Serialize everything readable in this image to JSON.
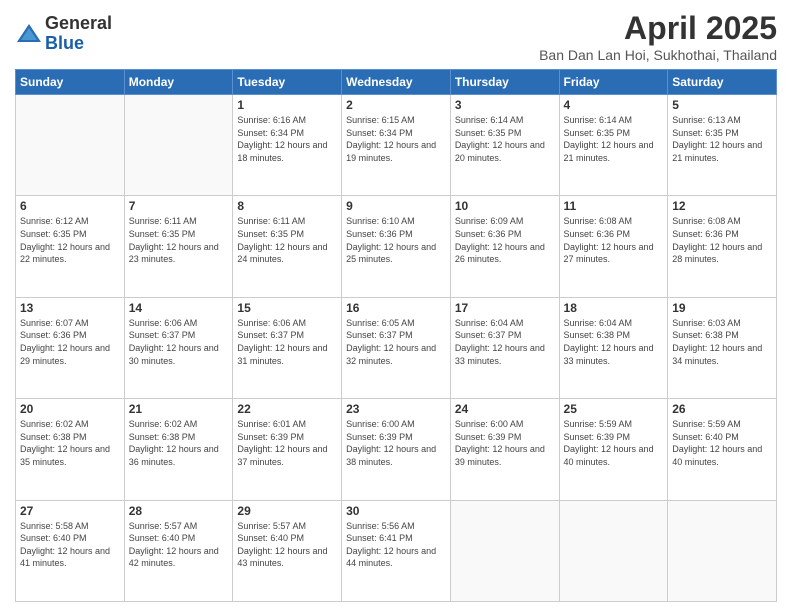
{
  "logo": {
    "general": "General",
    "blue": "Blue"
  },
  "title": "April 2025",
  "subtitle": "Ban Dan Lan Hoi, Sukhothai, Thailand",
  "days_of_week": [
    "Sunday",
    "Monday",
    "Tuesday",
    "Wednesday",
    "Thursday",
    "Friday",
    "Saturday"
  ],
  "weeks": [
    [
      {
        "day": "",
        "sunrise": "",
        "sunset": "",
        "daylight": ""
      },
      {
        "day": "",
        "sunrise": "",
        "sunset": "",
        "daylight": ""
      },
      {
        "day": "1",
        "sunrise": "Sunrise: 6:16 AM",
        "sunset": "Sunset: 6:34 PM",
        "daylight": "Daylight: 12 hours and 18 minutes."
      },
      {
        "day": "2",
        "sunrise": "Sunrise: 6:15 AM",
        "sunset": "Sunset: 6:34 PM",
        "daylight": "Daylight: 12 hours and 19 minutes."
      },
      {
        "day": "3",
        "sunrise": "Sunrise: 6:14 AM",
        "sunset": "Sunset: 6:35 PM",
        "daylight": "Daylight: 12 hours and 20 minutes."
      },
      {
        "day": "4",
        "sunrise": "Sunrise: 6:14 AM",
        "sunset": "Sunset: 6:35 PM",
        "daylight": "Daylight: 12 hours and 21 minutes."
      },
      {
        "day": "5",
        "sunrise": "Sunrise: 6:13 AM",
        "sunset": "Sunset: 6:35 PM",
        "daylight": "Daylight: 12 hours and 21 minutes."
      }
    ],
    [
      {
        "day": "6",
        "sunrise": "Sunrise: 6:12 AM",
        "sunset": "Sunset: 6:35 PM",
        "daylight": "Daylight: 12 hours and 22 minutes."
      },
      {
        "day": "7",
        "sunrise": "Sunrise: 6:11 AM",
        "sunset": "Sunset: 6:35 PM",
        "daylight": "Daylight: 12 hours and 23 minutes."
      },
      {
        "day": "8",
        "sunrise": "Sunrise: 6:11 AM",
        "sunset": "Sunset: 6:35 PM",
        "daylight": "Daylight: 12 hours and 24 minutes."
      },
      {
        "day": "9",
        "sunrise": "Sunrise: 6:10 AM",
        "sunset": "Sunset: 6:36 PM",
        "daylight": "Daylight: 12 hours and 25 minutes."
      },
      {
        "day": "10",
        "sunrise": "Sunrise: 6:09 AM",
        "sunset": "Sunset: 6:36 PM",
        "daylight": "Daylight: 12 hours and 26 minutes."
      },
      {
        "day": "11",
        "sunrise": "Sunrise: 6:08 AM",
        "sunset": "Sunset: 6:36 PM",
        "daylight": "Daylight: 12 hours and 27 minutes."
      },
      {
        "day": "12",
        "sunrise": "Sunrise: 6:08 AM",
        "sunset": "Sunset: 6:36 PM",
        "daylight": "Daylight: 12 hours and 28 minutes."
      }
    ],
    [
      {
        "day": "13",
        "sunrise": "Sunrise: 6:07 AM",
        "sunset": "Sunset: 6:36 PM",
        "daylight": "Daylight: 12 hours and 29 minutes."
      },
      {
        "day": "14",
        "sunrise": "Sunrise: 6:06 AM",
        "sunset": "Sunset: 6:37 PM",
        "daylight": "Daylight: 12 hours and 30 minutes."
      },
      {
        "day": "15",
        "sunrise": "Sunrise: 6:06 AM",
        "sunset": "Sunset: 6:37 PM",
        "daylight": "Daylight: 12 hours and 31 minutes."
      },
      {
        "day": "16",
        "sunrise": "Sunrise: 6:05 AM",
        "sunset": "Sunset: 6:37 PM",
        "daylight": "Daylight: 12 hours and 32 minutes."
      },
      {
        "day": "17",
        "sunrise": "Sunrise: 6:04 AM",
        "sunset": "Sunset: 6:37 PM",
        "daylight": "Daylight: 12 hours and 33 minutes."
      },
      {
        "day": "18",
        "sunrise": "Sunrise: 6:04 AM",
        "sunset": "Sunset: 6:38 PM",
        "daylight": "Daylight: 12 hours and 33 minutes."
      },
      {
        "day": "19",
        "sunrise": "Sunrise: 6:03 AM",
        "sunset": "Sunset: 6:38 PM",
        "daylight": "Daylight: 12 hours and 34 minutes."
      }
    ],
    [
      {
        "day": "20",
        "sunrise": "Sunrise: 6:02 AM",
        "sunset": "Sunset: 6:38 PM",
        "daylight": "Daylight: 12 hours and 35 minutes."
      },
      {
        "day": "21",
        "sunrise": "Sunrise: 6:02 AM",
        "sunset": "Sunset: 6:38 PM",
        "daylight": "Daylight: 12 hours and 36 minutes."
      },
      {
        "day": "22",
        "sunrise": "Sunrise: 6:01 AM",
        "sunset": "Sunset: 6:39 PM",
        "daylight": "Daylight: 12 hours and 37 minutes."
      },
      {
        "day": "23",
        "sunrise": "Sunrise: 6:00 AM",
        "sunset": "Sunset: 6:39 PM",
        "daylight": "Daylight: 12 hours and 38 minutes."
      },
      {
        "day": "24",
        "sunrise": "Sunrise: 6:00 AM",
        "sunset": "Sunset: 6:39 PM",
        "daylight": "Daylight: 12 hours and 39 minutes."
      },
      {
        "day": "25",
        "sunrise": "Sunrise: 5:59 AM",
        "sunset": "Sunset: 6:39 PM",
        "daylight": "Daylight: 12 hours and 40 minutes."
      },
      {
        "day": "26",
        "sunrise": "Sunrise: 5:59 AM",
        "sunset": "Sunset: 6:40 PM",
        "daylight": "Daylight: 12 hours and 40 minutes."
      }
    ],
    [
      {
        "day": "27",
        "sunrise": "Sunrise: 5:58 AM",
        "sunset": "Sunset: 6:40 PM",
        "daylight": "Daylight: 12 hours and 41 minutes."
      },
      {
        "day": "28",
        "sunrise": "Sunrise: 5:57 AM",
        "sunset": "Sunset: 6:40 PM",
        "daylight": "Daylight: 12 hours and 42 minutes."
      },
      {
        "day": "29",
        "sunrise": "Sunrise: 5:57 AM",
        "sunset": "Sunset: 6:40 PM",
        "daylight": "Daylight: 12 hours and 43 minutes."
      },
      {
        "day": "30",
        "sunrise": "Sunrise: 5:56 AM",
        "sunset": "Sunset: 6:41 PM",
        "daylight": "Daylight: 12 hours and 44 minutes."
      },
      {
        "day": "",
        "sunrise": "",
        "sunset": "",
        "daylight": ""
      },
      {
        "day": "",
        "sunrise": "",
        "sunset": "",
        "daylight": ""
      },
      {
        "day": "",
        "sunrise": "",
        "sunset": "",
        "daylight": ""
      }
    ]
  ]
}
